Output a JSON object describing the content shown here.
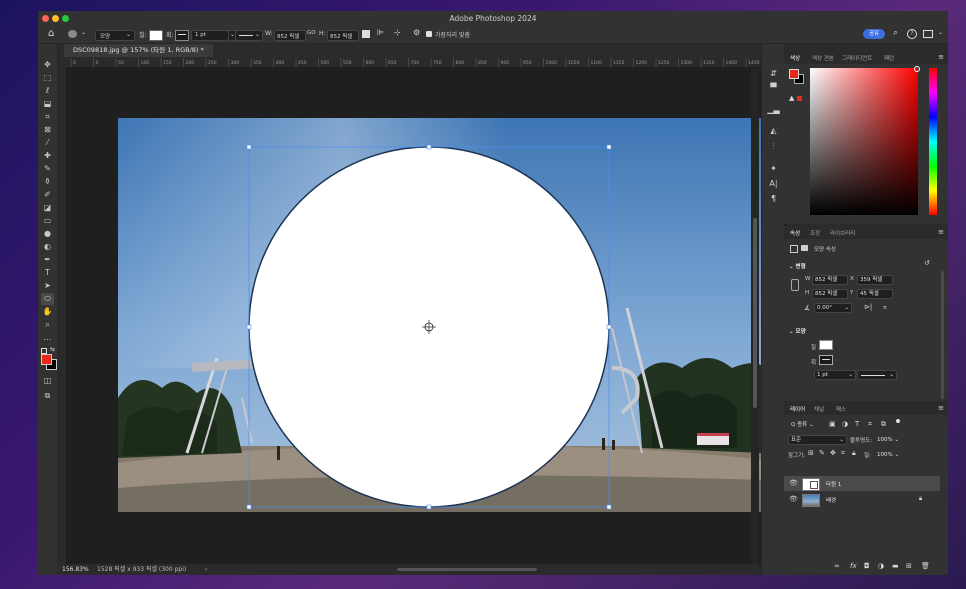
{
  "window": {
    "title": "Adobe Photoshop 2024",
    "traffic_colors": [
      "#ff5f57",
      "#febc2e",
      "#28c840"
    ]
  },
  "options_bar": {
    "shape_mode": "모양",
    "fill_label": "칠:",
    "stroke_label": "획:",
    "stroke_width": "1 pt",
    "w_label": "W:",
    "w_value": "852 픽셀",
    "link_label": "GO",
    "h_label": "H:",
    "h_value": "852 픽셀",
    "align_edges": "가장자리 맞춤",
    "share_button": "공유"
  },
  "document_tab": {
    "label": "DSC09818.jpg @ 157% (타원 1, RGB/8) *"
  },
  "ruler": {
    "ticks": [
      "0",
      "0",
      "50",
      "100",
      "150",
      "200",
      "250",
      "300",
      "350",
      "400",
      "450",
      "500",
      "550",
      "600",
      "650",
      "700",
      "750",
      "800",
      "850",
      "900",
      "950",
      "1000",
      "1050",
      "1100",
      "1150",
      "1200",
      "1250",
      "1300",
      "1350",
      "1400",
      "1450",
      "1500"
    ]
  },
  "status_bar": {
    "zoom": "156.83%",
    "doc_info": "1528 픽셀 x 933 픽셀 (300 ppi)",
    "arrow": "›"
  },
  "color_panel": {
    "tabs": [
      "색상",
      "색상 견본",
      "그레이디언트",
      "패턴"
    ],
    "active_tab": "색상",
    "foreground": "#e8281a",
    "background": "#000000",
    "hue_color": "#ff0000"
  },
  "properties_panel": {
    "tabs": [
      "속성",
      "조정",
      "라이브러리"
    ],
    "active_tab": "속성",
    "type_label": "모양 속성",
    "transform_header": "변형",
    "w_label": "W",
    "w_value": "852 픽셀",
    "x_label": "X",
    "x_value": "359 픽셀",
    "h_label": "H",
    "h_value": "852 픽셀",
    "y_label": "Y",
    "y_value": "45 픽셀",
    "angle": "0.00°",
    "appearance_header": "모양",
    "fill_label": "칠",
    "stroke_label": "획",
    "stroke_width": "1 pt"
  },
  "layers_panel": {
    "tabs": [
      "레이어",
      "채널",
      "패스"
    ],
    "active_tab": "레이어",
    "filter_label": "Q 종류",
    "blend_mode": "표준",
    "opacity_label": "불투명도:",
    "opacity_value": "100%",
    "lock_label": "잠그기:",
    "fill_label": "칠:",
    "fill_value": "100%",
    "layers": [
      {
        "name": "타원 1",
        "selected": true
      },
      {
        "name": "배경",
        "selected": false
      }
    ]
  }
}
